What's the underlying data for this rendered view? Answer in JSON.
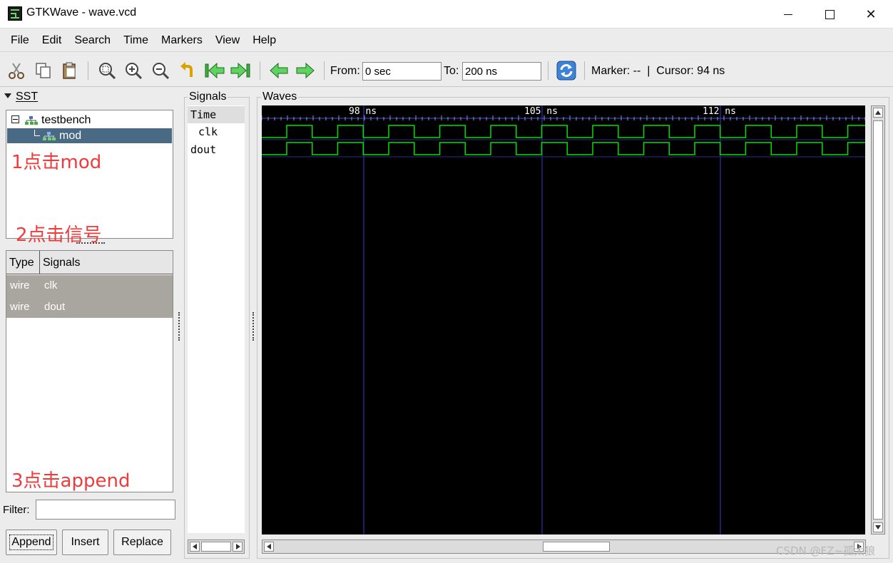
{
  "window": {
    "title": "GTKWave - wave.vcd",
    "close_glyph": "✕"
  },
  "menu": [
    "File",
    "Edit",
    "Search",
    "Time",
    "Markers",
    "View",
    "Help"
  ],
  "toolbar": {
    "icons": [
      "cut-icon",
      "copy-icon",
      "paste-icon",
      "zoom-fit-icon",
      "zoom-in-icon",
      "zoom-out-icon",
      "undo-icon",
      "jump-start-icon",
      "jump-end-icon",
      "prev-edge-icon",
      "next-edge-icon",
      "reload-icon"
    ],
    "from_label": "From:",
    "from_value": "0 sec",
    "to_label": "To:",
    "to_value": "200 ns",
    "marker_text": "Marker: --  |  Cursor: 94 ns"
  },
  "sst": {
    "title": "SST",
    "tree": [
      {
        "label": "testbench",
        "level": 0
      },
      {
        "label": "mod",
        "level": 1,
        "selected": true
      }
    ],
    "annotations": [
      "1点击mod",
      "2点击信号",
      "3点击append"
    ],
    "table": {
      "headers": [
        "Type",
        "Signals"
      ],
      "rows": [
        {
          "type": "wire",
          "name": "clk"
        },
        {
          "type": "wire",
          "name": "dout"
        }
      ]
    },
    "filter_label": "Filter:",
    "buttons": {
      "append": "Append",
      "insert": "Insert",
      "replace": "Replace"
    }
  },
  "signals_panel": {
    "title": "Signals",
    "rows": [
      "Time",
      "clk",
      "dout"
    ]
  },
  "waves_panel": {
    "title": "Waves",
    "time_labels": [
      "98 ns",
      "105 ns",
      "112 ns"
    ],
    "colors": {
      "background": "#000000",
      "trace": "#00e000",
      "grid": "#3a3ad0",
      "tick": "#9090ff"
    }
  },
  "watermark": "CSDN @FZ~孤太狼"
}
